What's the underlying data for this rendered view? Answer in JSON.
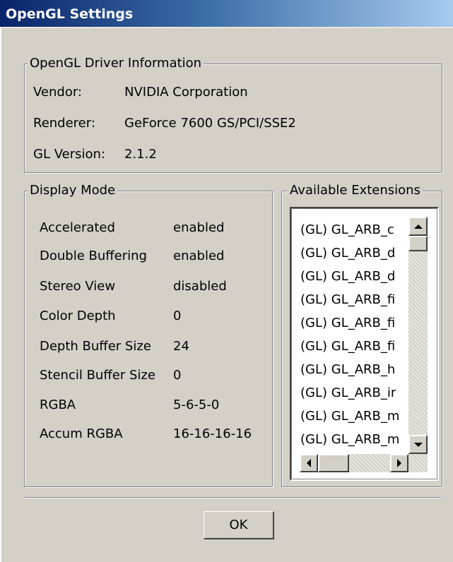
{
  "window": {
    "title": "OpenGL Settings"
  },
  "driver_info": {
    "legend": "OpenGL Driver Information",
    "rows": [
      {
        "label": "Vendor:",
        "value": "NVIDIA Corporation"
      },
      {
        "label": "Renderer:",
        "value": "GeForce 7600 GS/PCI/SSE2"
      },
      {
        "label": "GL Version:",
        "value": "2.1.2"
      }
    ]
  },
  "display_mode": {
    "legend": "Display Mode",
    "rows": [
      {
        "label": "Accelerated",
        "value": "enabled"
      },
      {
        "label": "Double Buffering",
        "value": "enabled"
      },
      {
        "label": "Stereo View",
        "value": "disabled"
      },
      {
        "label": "Color Depth",
        "value": "0"
      },
      {
        "label": "Depth Buffer Size",
        "value": "24"
      },
      {
        "label": "Stencil Buffer Size",
        "value": "0"
      },
      {
        "label": "RGBA",
        "value": "5-6-5-0"
      },
      {
        "label": "Accum RGBA",
        "value": "16-16-16-16"
      }
    ]
  },
  "extensions": {
    "legend": "Available Extensions",
    "items": [
      "(GL) GL_ARB_c",
      "(GL) GL_ARB_d",
      "(GL) GL_ARB_d",
      "(GL) GL_ARB_fi",
      "(GL) GL_ARB_fi",
      "(GL) GL_ARB_fi",
      "(GL) GL_ARB_h",
      "(GL) GL_ARB_ir",
      "(GL) GL_ARB_m",
      "(GL) GL_ARB_m"
    ]
  },
  "buttons": {
    "ok": "OK"
  }
}
